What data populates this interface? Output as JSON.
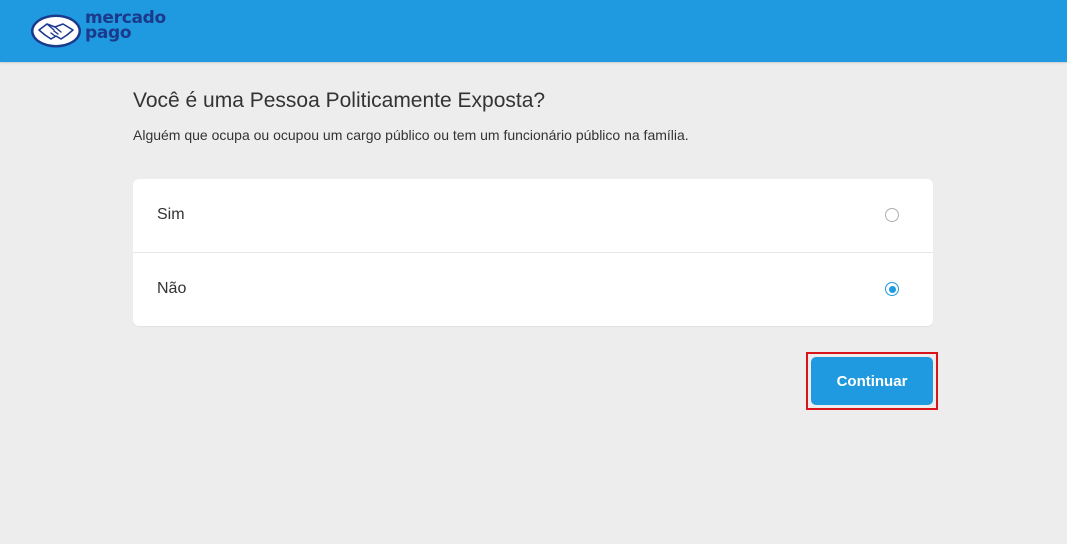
{
  "header": {
    "brand_line1": "mercado",
    "brand_line2": "pago",
    "logo_icon": "handshake-icon",
    "bg_color": "#1f9ae0"
  },
  "question": {
    "title": "Você é uma Pessoa Politicamente Exposta?",
    "subtitle": "Alguém que ocupa ou ocupou um cargo público ou tem um funcionário público na família."
  },
  "options": [
    {
      "label": "Sim",
      "selected": false
    },
    {
      "label": "Não",
      "selected": true
    }
  ],
  "actions": {
    "continue_label": "Continuar",
    "accent_color": "#1f9ae0",
    "highlight_color": "#d9141b"
  }
}
